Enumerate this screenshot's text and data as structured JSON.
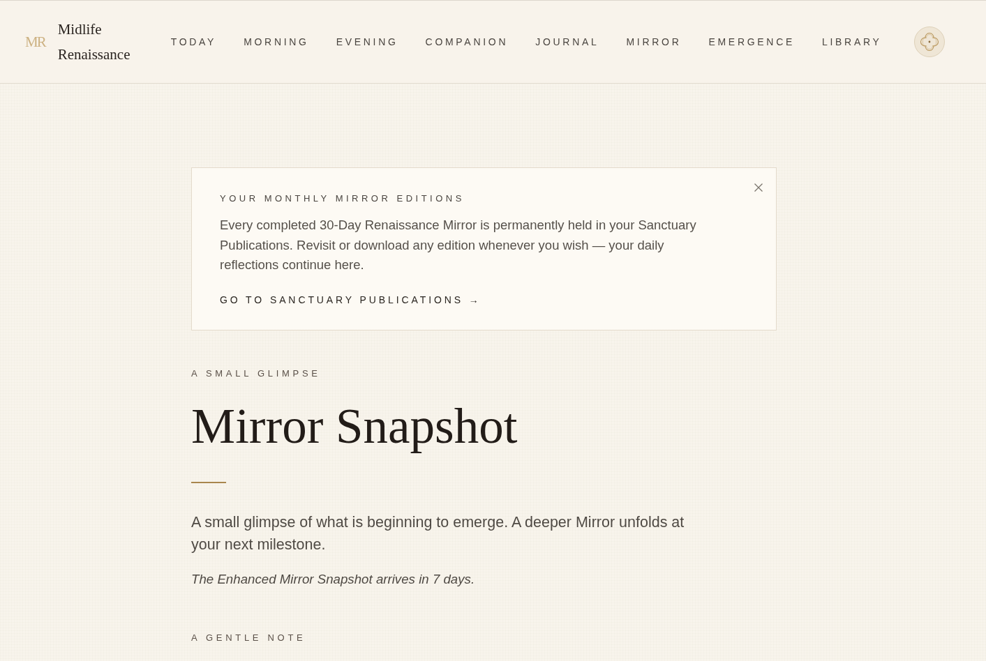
{
  "header": {
    "logo": {
      "monogram": "MR",
      "name": "Midlife Renaissance"
    },
    "nav": [
      {
        "label": "TODAY"
      },
      {
        "label": "MORNING"
      },
      {
        "label": "EVENING"
      },
      {
        "label": "COMPANION"
      },
      {
        "label": "JOURNAL"
      },
      {
        "label": "MIRROR"
      },
      {
        "label": "EMERGENCE"
      },
      {
        "label": "LIBRARY"
      }
    ]
  },
  "notice": {
    "title": "YOUR MONTHLY MIRROR EDITIONS",
    "body": "Every completed 30-Day Renaissance Mirror is permanently held in your Sanctuary Publications. Revisit or download any edition whenever you wish — your daily reflections continue here.",
    "link": "GO TO SANCTUARY PUBLICATIONS →"
  },
  "page": {
    "eyebrow": "A SMALL GLIMPSE",
    "title": "Mirror Snapshot",
    "intro": "A small glimpse of what is beginning to emerge. A deeper Mirror unfolds at your next milestone.",
    "note": "The Enhanced Mirror Snapshot arrives in 7 days.",
    "next_section": "A GENTLE NOTE"
  }
}
